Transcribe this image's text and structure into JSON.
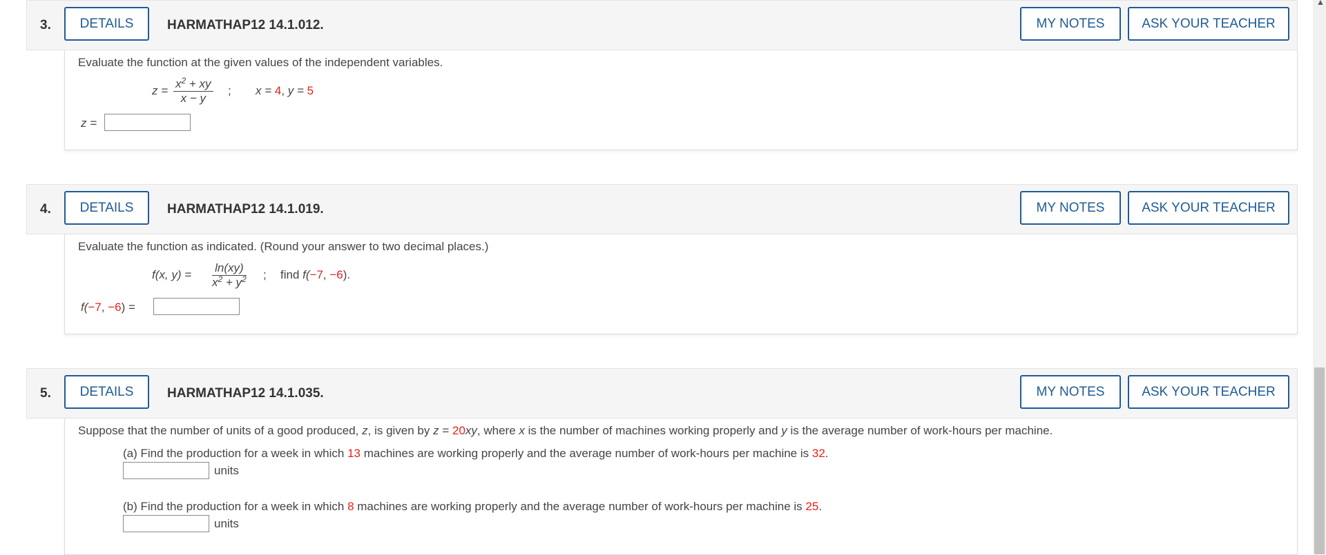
{
  "buttons": {
    "details": "DETAILS",
    "my_notes": "MY NOTES",
    "ask_teacher": "ASK YOUR TEACHER"
  },
  "q3": {
    "number": "3.",
    "code": "HARMATHAP12 14.1.012.",
    "instruction": "Evaluate the function at the given values of the independent variables.",
    "z_eq": "z =",
    "frac_num_pre": "x",
    "frac_num_exp": "2",
    "frac_num_post": " + xy",
    "frac_den": "x − y",
    "semi": ";",
    "x_label": "x = ",
    "x_val": "4",
    "comma": ", ",
    "y_label": "y = ",
    "y_val": "5",
    "answer_label": "z ="
  },
  "q4": {
    "number": "4.",
    "code": "HARMATHAP12 14.1.019.",
    "instruction": "Evaluate the function as indicated. (Round your answer to two decimal places.)",
    "fxy": "f(x, y) =",
    "frac_num": "ln(xy)",
    "den_x": "x",
    "den_exp1": "2",
    "den_mid": " + y",
    "den_exp2": "2",
    "semi": ";",
    "find_text": "find ",
    "f_open": "f(",
    "a_val": "−7",
    "comma": ", ",
    "b_val": "−6",
    "f_close": ").",
    "ans_f_open": "f(",
    "ans_a": "−7",
    "ans_comma": ", ",
    "ans_b": "−6",
    "ans_close": ") ="
  },
  "q5": {
    "number": "5.",
    "code": "HARMATHAP12 14.1.035.",
    "intro_1": "Suppose that the number of units of a good produced, ",
    "intro_z": "z",
    "intro_2": ", is given by  ",
    "intro_z2": "z",
    "intro_eq": " = ",
    "coef": "20",
    "xy": "xy",
    "intro_3": ",  where ",
    "intro_x": "x",
    "intro_4": " is the number of machines working properly and ",
    "intro_y": "y",
    "intro_5": " is the average number of work-hours per machine.",
    "a_1": "(a) Find the production for a week in which ",
    "a_machines": "13",
    "a_2": " machines are working properly and the average number of work-hours per machine is ",
    "a_hours": "32",
    "a_end": ".",
    "b_1": "(b) Find the production for a week in which ",
    "b_machines": "8",
    "b_2": " machines are working properly and the average number of work-hours per machine is ",
    "b_hours": "25",
    "b_end": ".",
    "units": "units"
  },
  "colors": {
    "accent": "#1f5b94",
    "highlight": "#e8201a"
  }
}
